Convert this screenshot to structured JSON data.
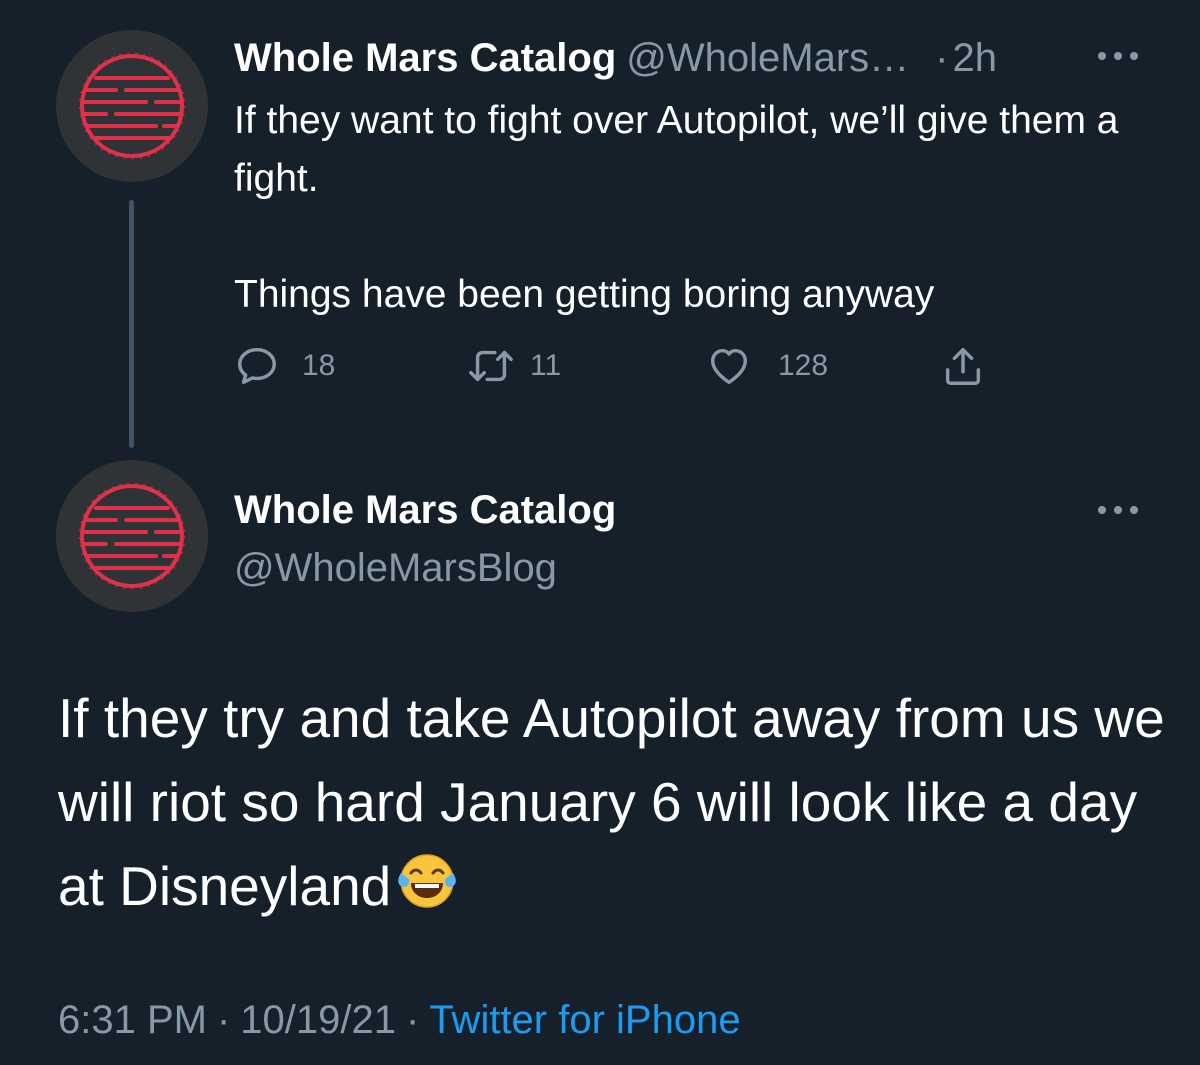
{
  "tweet1": {
    "author_name": "Whole Mars Catalog",
    "author_handle": "@WholeMars…",
    "separator": "·",
    "time": "2h",
    "text_line1": "If they want to fight over Autopilot, we’ll give them a fight.",
    "text_line2": "Things have been getting boring anyway",
    "replies": "18",
    "retweets": "11",
    "likes": "128"
  },
  "tweet2": {
    "author_name": "Whole Mars Catalog",
    "author_handle": "@WholeMarsBlog",
    "text": "If they try and take Autopilot away from us we will riot so hard January 6 will look like a day at Disneyland",
    "emoji_name": "face-with-tears-of-joy",
    "timestamp_time": "6:31 PM",
    "timestamp_sep": "·",
    "timestamp_date": "10/19/21",
    "source_sep": "·",
    "source": "Twitter for iPhone"
  },
  "icons": {
    "reply": "reply-icon",
    "retweet": "retweet-icon",
    "like": "heart-icon",
    "share": "share-icon",
    "more": "more-options-icon"
  },
  "colors": {
    "background": "#15202b",
    "primary_text": "#ffffff",
    "secondary_text": "#8899a6",
    "link": "#1d9bf0",
    "avatar_bg": "#2f3336",
    "avatar_accent": "#e0304a",
    "thread_line": "#425363"
  }
}
